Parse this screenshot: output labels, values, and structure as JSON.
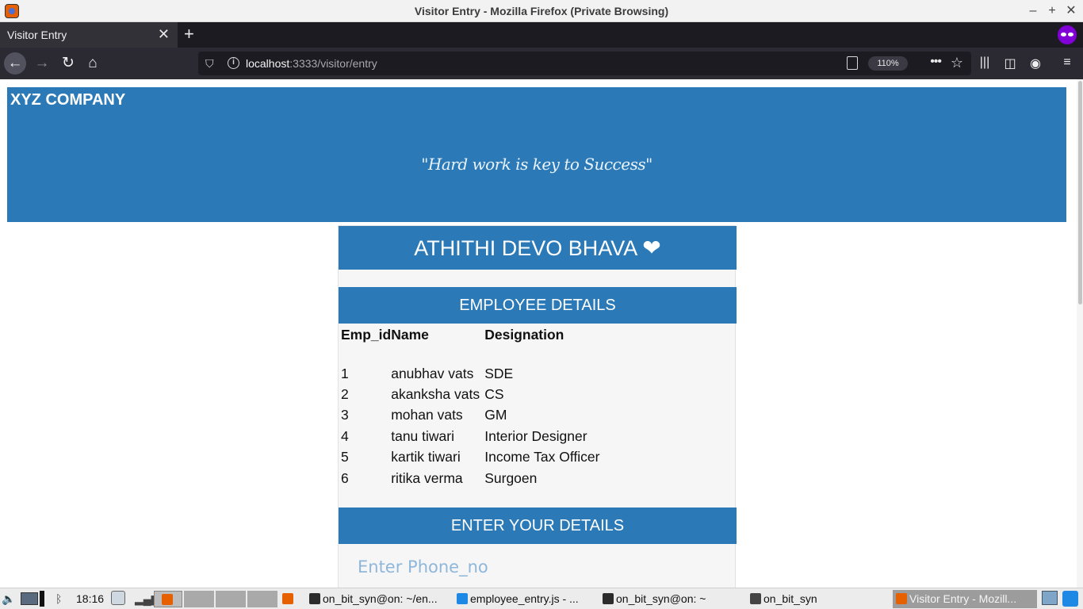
{
  "window": {
    "title": "Visitor Entry - Mozilla Firefox (Private Browsing)"
  },
  "browser": {
    "tab_title": "Visitor Entry",
    "url_host": "localhost",
    "url_rest": ":3333/visitor/entry",
    "zoom": "110%"
  },
  "page": {
    "company": "XYZ COMPANY",
    "tagline": "\"Hard work is key to Success\"",
    "welcome": "ATHITHI DEVO BHAVA",
    "employee_heading": "EMPLOYEE DETAILS",
    "table_headers": [
      "Emp_id",
      "Name",
      "Designation"
    ],
    "employees": [
      {
        "id": "1",
        "name": "anubhav vats",
        "designation": "SDE"
      },
      {
        "id": "2",
        "name": "akanksha vats",
        "designation": "CS"
      },
      {
        "id": "3",
        "name": "mohan vats",
        "designation": "GM"
      },
      {
        "id": "4",
        "name": "tanu tiwari",
        "designation": "Interior Designer"
      },
      {
        "id": "5",
        "name": "kartik tiwari",
        "designation": "Income Tax Officer"
      },
      {
        "id": "6",
        "name": "ritika verma",
        "designation": "Surgoen"
      }
    ],
    "enter_heading": "ENTER YOUR DETAILS",
    "phone_placeholder": "Enter Phone_no"
  },
  "taskbar": {
    "clock": "18:16",
    "tasks": [
      "on_bit_syn@on: ~/en...",
      "employee_entry.js - ...",
      "on_bit_syn@on: ~",
      "on_bit_syn",
      "Visitor Entry - Mozill..."
    ]
  },
  "colors": {
    "brand_blue": "#2b7ab7",
    "firefox_private": "#8000d7"
  }
}
